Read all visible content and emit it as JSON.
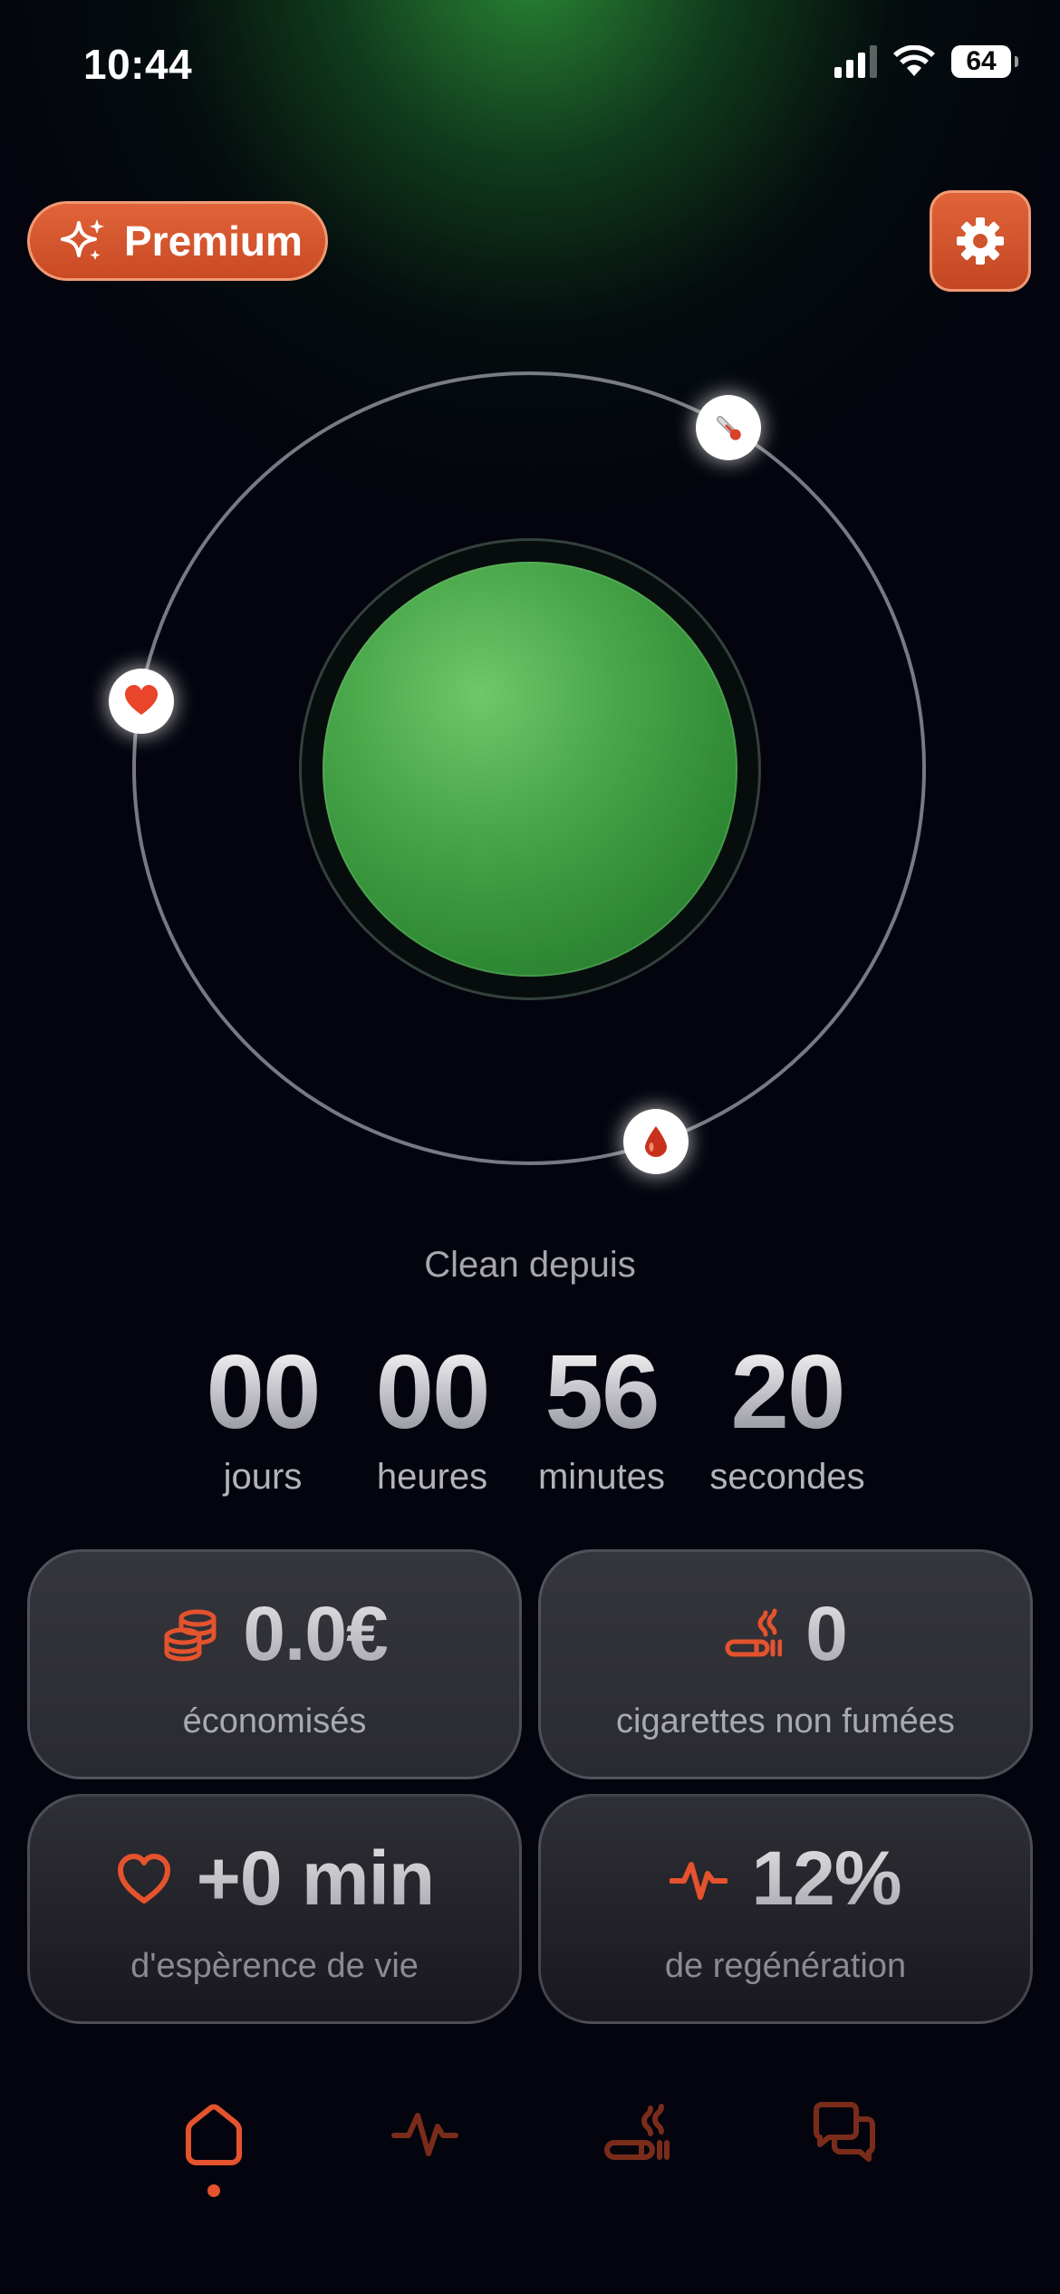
{
  "status_bar": {
    "time": "10:44",
    "battery": "64",
    "signal_bars_active": 3,
    "signal_bars_total": 4,
    "icons": [
      "signal-icon",
      "wifi-icon",
      "battery-icon"
    ]
  },
  "header": {
    "premium_label": "Premium",
    "premium_icon": "sparkles-icon",
    "settings_icon": "gear-icon"
  },
  "orbit": {
    "markers": [
      "thermometer-icon",
      "heart-icon",
      "blood-drop-icon"
    ]
  },
  "timer": {
    "caption": "Clean depuis",
    "units": [
      {
        "value": "00",
        "label": "jours"
      },
      {
        "value": "00",
        "label": "heures"
      },
      {
        "value": "56",
        "label": "minutes"
      },
      {
        "value": "20",
        "label": "secondes"
      }
    ]
  },
  "stats": [
    {
      "icon": "coins-icon",
      "value": "0.0€",
      "label": "économisés"
    },
    {
      "icon": "cigarette-icon",
      "value": "0",
      "label": "cigarettes non fumées"
    },
    {
      "icon": "heart-outline-icon",
      "value": "+0 min",
      "label": "d'espèrence de vie"
    },
    {
      "icon": "pulse-icon",
      "value": "12%",
      "label": "de regénération"
    }
  ],
  "tab_bar": {
    "tabs": [
      "home-icon",
      "activity-icon",
      "cigarette-icon",
      "chat-icon"
    ],
    "active_index": 0
  },
  "colors": {
    "accent": "#e4532d",
    "accent_dim": "#7a2c1a",
    "background": "#03040d",
    "sphere_green": "#4aa74a",
    "card": "#32323a"
  }
}
